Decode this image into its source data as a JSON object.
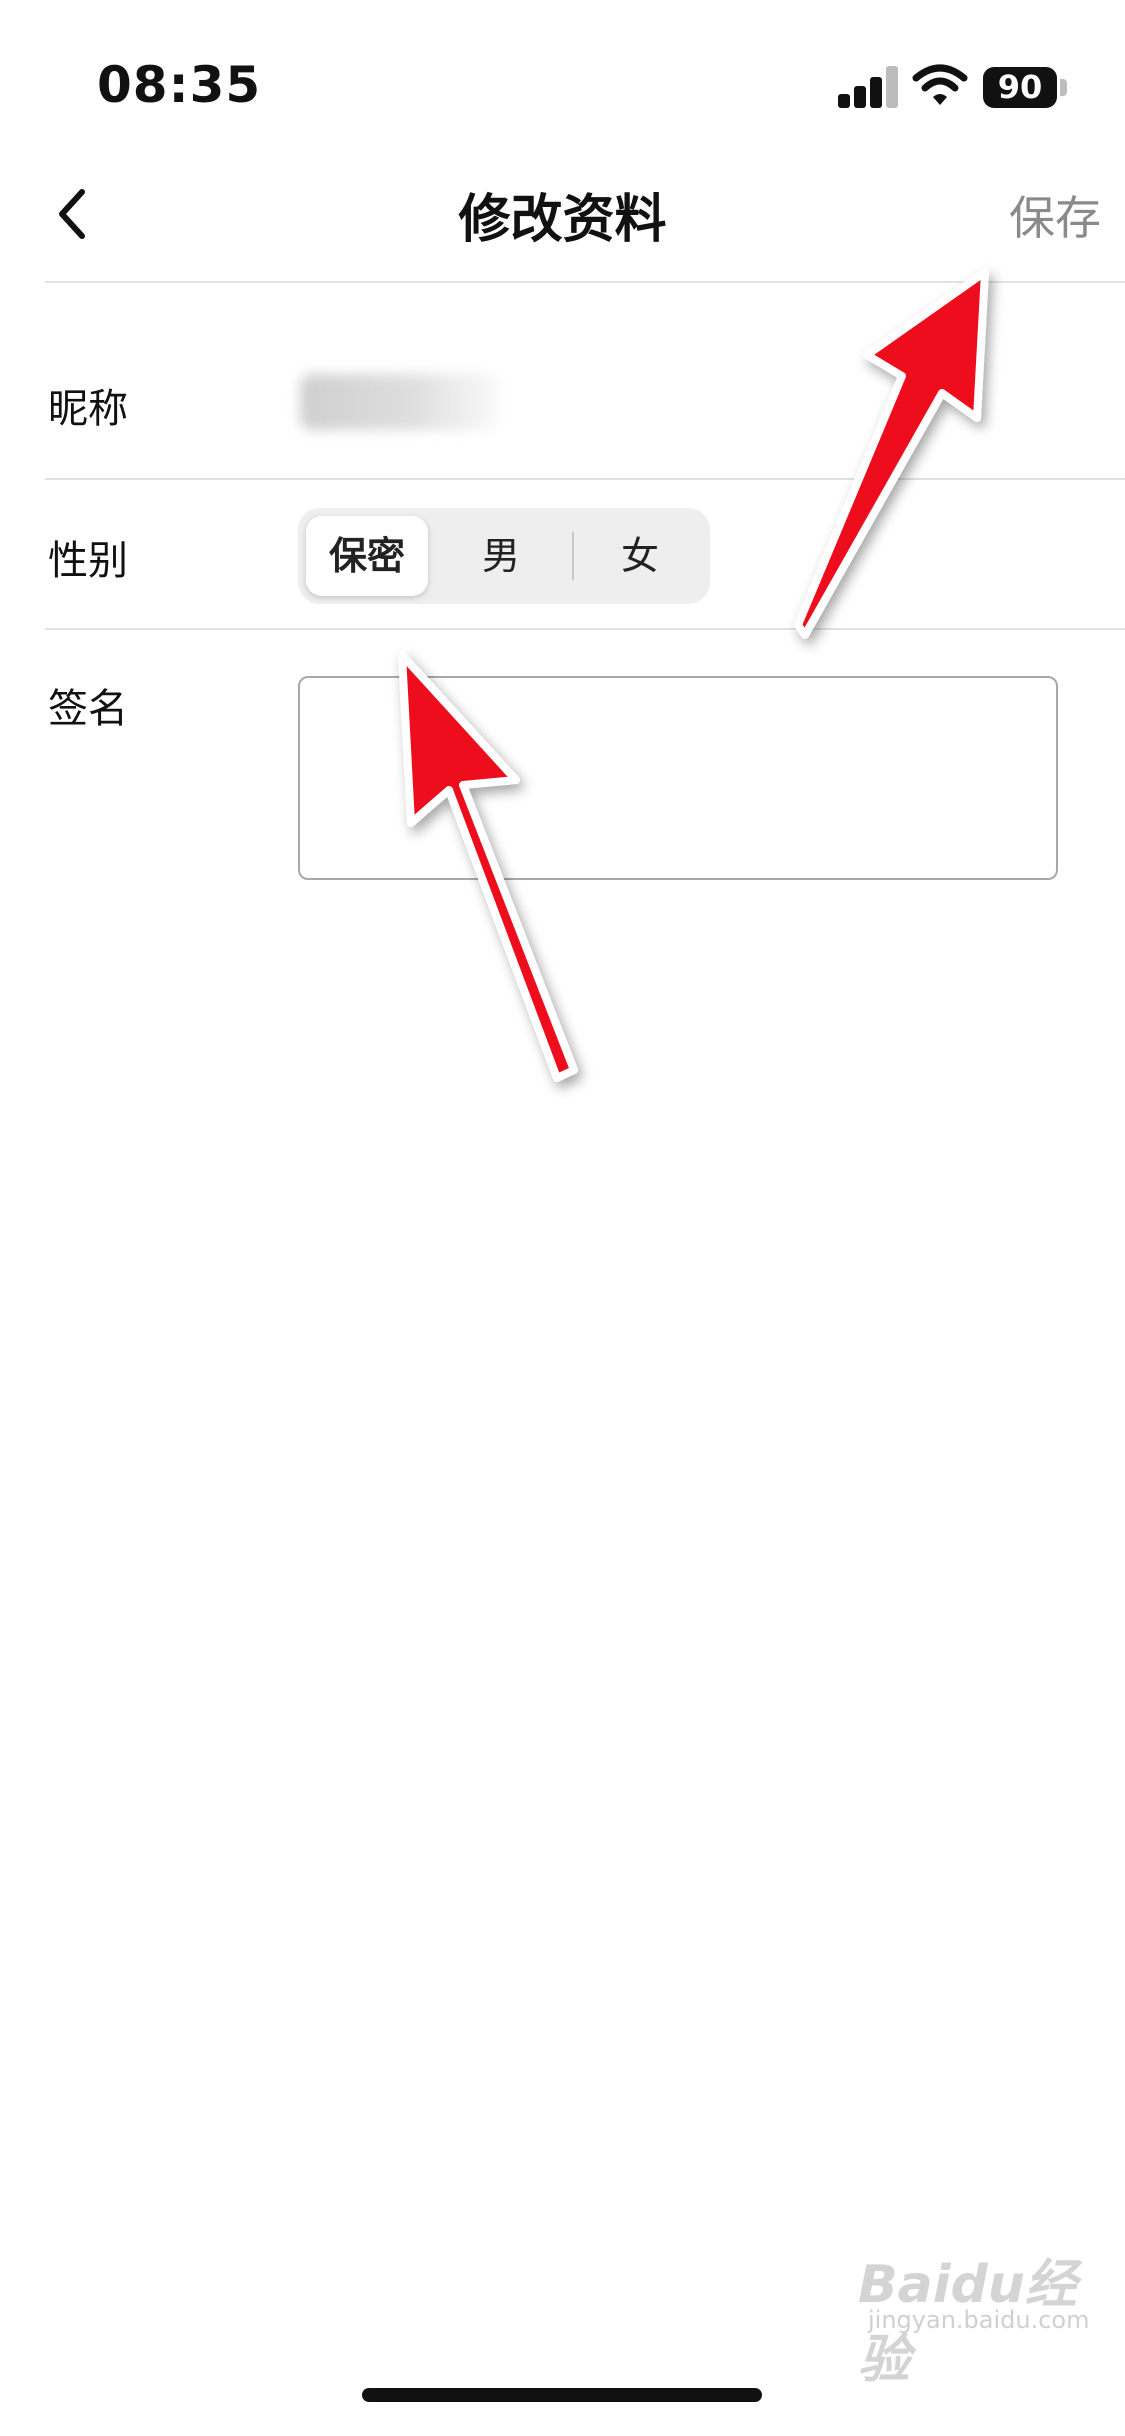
{
  "status_bar": {
    "time": "08:35",
    "battery": "90"
  },
  "nav": {
    "title": "修改资料",
    "save_label": "保存",
    "back_icon": "chevron-left-icon"
  },
  "form": {
    "nickname_label": "昵称",
    "gender_label": "性别",
    "gender_options": [
      "保密",
      "男",
      "女"
    ],
    "gender_selected": "保密",
    "signature_label": "签名",
    "signature_value": ""
  },
  "watermark": {
    "logo": "Baidu经验",
    "sub": "jingyan.baidu.com"
  },
  "colors": {
    "accent_arrow": "#ee0f1a",
    "save_text": "#8a8a8a",
    "divider": "#e2e2e2"
  }
}
